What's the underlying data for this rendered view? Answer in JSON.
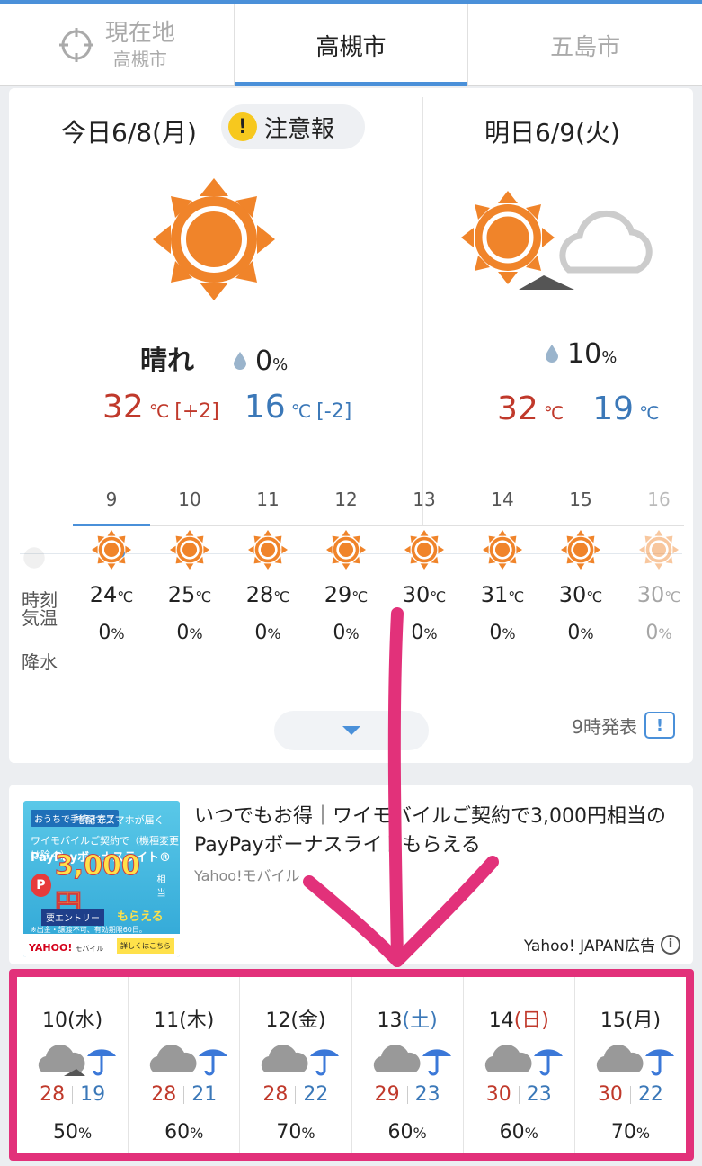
{
  "tabs": [
    {
      "label": "現在地",
      "sublabel": "高槻市"
    },
    {
      "label": "高槻市"
    },
    {
      "label": "五島市"
    }
  ],
  "today": {
    "title": "今日6/8(月)",
    "alert": "注意報",
    "weather": "晴れ",
    "pop": "0",
    "pop_unit": "%",
    "high": "32",
    "high_diff": "[+2]",
    "low": "16",
    "low_diff": "[-2]",
    "temp_unit": "℃"
  },
  "tomorrow": {
    "title": "明日6/9(火)",
    "pop": "10",
    "pop_unit": "%",
    "high": "32",
    "low": "19",
    "temp_unit": "℃"
  },
  "hourly": {
    "label_time": "時刻",
    "label_temp": "気温",
    "label_pop": "降水",
    "temp_unit": "℃",
    "pop_unit": "%",
    "hours": [
      {
        "hour": "9",
        "temp": "24",
        "pop": "0"
      },
      {
        "hour": "10",
        "temp": "25",
        "pop": "0"
      },
      {
        "hour": "11",
        "temp": "28",
        "pop": "0"
      },
      {
        "hour": "12",
        "temp": "29",
        "pop": "0"
      },
      {
        "hour": "13",
        "temp": "30",
        "pop": "0"
      },
      {
        "hour": "14",
        "temp": "31",
        "pop": "0"
      },
      {
        "hour": "15",
        "temp": "30",
        "pop": "0"
      },
      {
        "hour": "16",
        "temp": "30",
        "pop": "0"
      }
    ],
    "published": "9時発表"
  },
  "ad": {
    "title": "いつでもお得｜ワイモバイルご契約で3,000円相当のPayPayボーナスライトもらえる",
    "sponsor": "Yahoo!モバイル",
    "label": "Yahoo! JAPAN広告",
    "banner": {
      "line1": "おうちで手続き完了",
      "line2": "宅配でスマホが届く",
      "line3": "ワイモバイルご契約で（機種変更は除く）",
      "line4": "PayPayボーナスライト®",
      "amount": "3,000円",
      "amount_suffix": "相当",
      "entry": "要エントリー",
      "get": "もらえる",
      "note": "※出金・譲渡不可、有効期限60日。",
      "brand": "YAHOO!",
      "brand_sub": "モバイル",
      "more": "詳しくはこちら"
    }
  },
  "weekly": [
    {
      "date": "10",
      "dow": "(水)",
      "dow_type": "weekday",
      "high": "28",
      "low": "19",
      "pop": "50"
    },
    {
      "date": "11",
      "dow": "(木)",
      "dow_type": "weekday",
      "high": "28",
      "low": "21",
      "pop": "60"
    },
    {
      "date": "12",
      "dow": "(金)",
      "dow_type": "weekday",
      "high": "28",
      "low": "22",
      "pop": "70"
    },
    {
      "date": "13",
      "dow": "(土)",
      "dow_type": "sat",
      "high": "29",
      "low": "23",
      "pop": "60"
    },
    {
      "date": "14",
      "dow": "(日)",
      "dow_type": "sun",
      "high": "30",
      "low": "23",
      "pop": "60"
    },
    {
      "date": "15",
      "dow": "(月)",
      "dow_type": "weekday",
      "high": "30",
      "low": "22",
      "pop": "70"
    }
  ],
  "weekly_pop_unit": "%",
  "colors": {
    "accent": "#4a90d9",
    "high": "#c0392b",
    "low": "#3b78b8",
    "sun": "#f0842a",
    "alert": "#f7c81e",
    "annotation": "#e2317a"
  },
  "icons": {
    "location": "crosshair-icon",
    "alert": "exclamation-icon",
    "sunny": "sun-icon",
    "sunny_then_cloudy": "sun-cloud-icon",
    "cloudy_rain": "cloud-umbrella-icon",
    "rain_drop": "drop-icon",
    "expand": "chevron-down-icon",
    "report": "report-icon",
    "info": "info-icon"
  }
}
